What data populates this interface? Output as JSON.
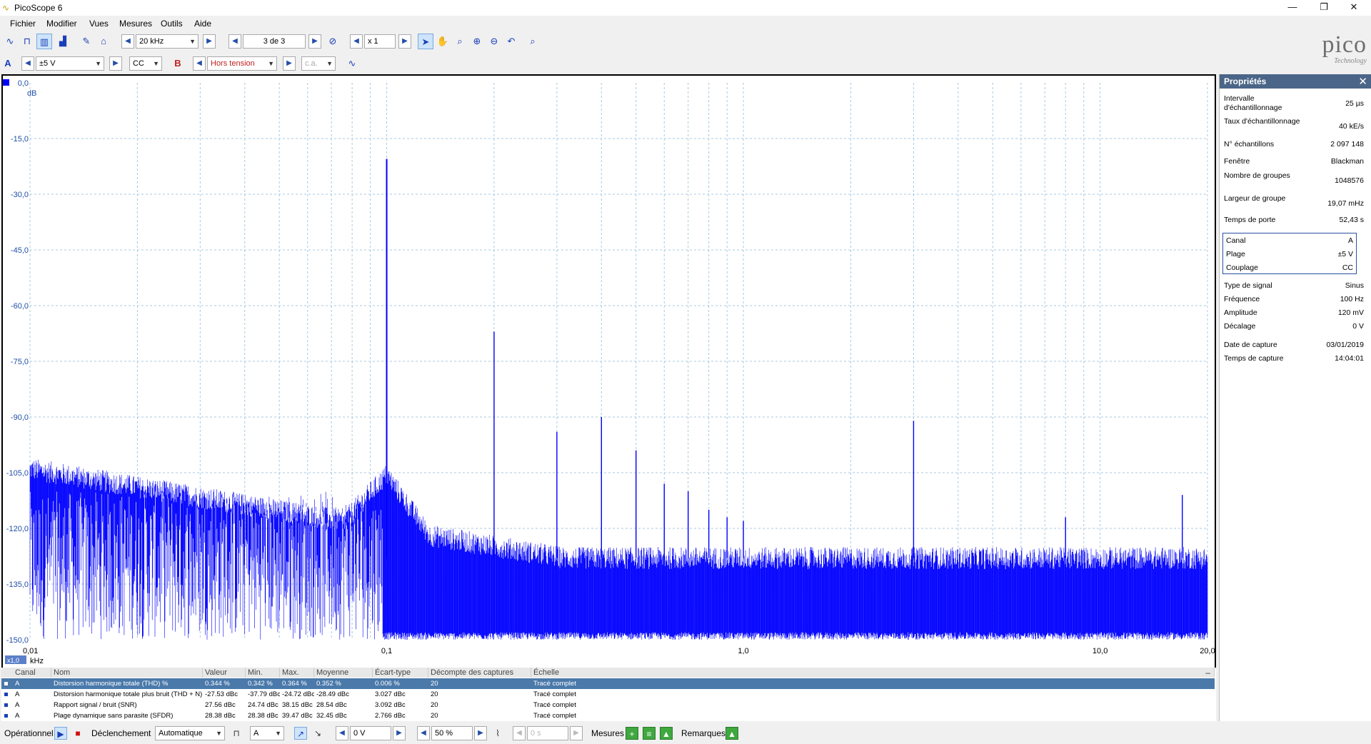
{
  "window": {
    "title": "PicoScope 6",
    "minimize": "—",
    "maximize": "❐",
    "close": "✕"
  },
  "menu": [
    "Fichier",
    "Modifier",
    "Vues",
    "Mesures",
    "Outils",
    "Aide"
  ],
  "toolbar": {
    "timebase": "20 kHz",
    "capture_page": "3 de 3",
    "zoom": "x 1"
  },
  "channel_toolbar": {
    "channel_a_label": "A",
    "channel_a_range": "±5 V",
    "channel_a_coupling": "CC",
    "channel_b_label": "B",
    "channel_b_range": "Hors tension",
    "channel_b_coupling": "c.a."
  },
  "logo": {
    "text": "pico",
    "sub": "Technology"
  },
  "plot": {
    "y_unit": "dB",
    "x_unit": "kHz",
    "x_scale_badge": "x1,0",
    "y_ticks": [
      "0,0",
      "-15,0",
      "-30,0",
      "-45,0",
      "-60,0",
      "-75,0",
      "-90,0",
      "-105,0",
      "-120,0",
      "-135,0",
      "-150,0"
    ],
    "x_ticks": [
      "0,01",
      "0,1",
      "1,0",
      "10,0",
      "20,0"
    ],
    "trace_color": "#0000ff",
    "grid_color": "#a8c8e0"
  },
  "chart_data": {
    "type": "line",
    "title": "",
    "xlabel": "kHz",
    "ylabel": "dB",
    "x_scale": "log",
    "xlim": [
      0.01,
      20.0
    ],
    "ylim": [
      -150,
      0
    ],
    "grid": true,
    "series": [
      {
        "x": [
          0.1,
          0.2,
          0.3,
          0.4,
          0.5,
          0.6,
          0.7,
          0.8,
          0.9,
          1.0,
          3.0,
          8.0,
          17.0
        ],
        "values": [
          -20.5,
          -67,
          -94,
          -90,
          -99,
          -108,
          -110,
          -115,
          -117,
          -118,
          -91,
          -117,
          -111
        ]
      }
    ],
    "noise_floor": {
      "low_freq": -107,
      "high_freq": -131
    }
  },
  "properties": {
    "header": "Propriétés",
    "close": "✕",
    "rows": [
      {
        "label": "Intervalle d'échantillonnage",
        "value": "25 µs"
      },
      {
        "label": "Taux d'échantillonnage",
        "value": "40 kE/s"
      },
      {
        "label": "N° échantillons",
        "value": "2 097 148"
      },
      {
        "label": "Fenêtre",
        "value": "Blackman"
      },
      {
        "label": "Nombre de groupes",
        "value": "1048576"
      },
      {
        "label": "Largeur de groupe",
        "value": "19,07 mHz"
      },
      {
        "label": "Temps de porte",
        "value": "52,43 s"
      }
    ],
    "channel_rows": [
      {
        "label": "Canal",
        "value": "A"
      },
      {
        "label": "Plage",
        "value": "±5 V"
      },
      {
        "label": "Couplage",
        "value": "CC"
      }
    ],
    "signal_rows": [
      {
        "label": "Type de signal",
        "value": "Sinus"
      },
      {
        "label": "Fréquence",
        "value": "100 Hz"
      },
      {
        "label": "Amplitude",
        "value": "120 mV"
      },
      {
        "label": "Décalage",
        "value": "0 V"
      }
    ],
    "capture_rows": [
      {
        "label": "Date de capture",
        "value": "03/01/2019"
      },
      {
        "label": "Temps de capture",
        "value": "14:04:01"
      }
    ]
  },
  "measurements": {
    "headers": [
      "Canal",
      "Nom",
      "Valeur",
      "Min.",
      "Max.",
      "Moyenne",
      "Écart-type",
      "Décompte des captures",
      "Échelle"
    ],
    "rows": [
      [
        "A",
        "Distorsion harmonique totale (THD) %",
        "0.344 %",
        "0.342 %",
        "0.364 %",
        "0.352 %",
        "0.006 %",
        "20",
        "Tracé complet"
      ],
      [
        "A",
        "Distorsion harmonique totale plus bruit (THD + N)",
        "-27.53 dBc",
        "-37.79 dBc",
        "-24.72 dBc",
        "-28.49 dBc",
        "3.027 dBc",
        "20",
        "Tracé complet"
      ],
      [
        "A",
        "Rapport signal / bruit (SNR)",
        "27.56 dBc",
        "24.74 dBc",
        "38.15 dBc",
        "28.54 dBc",
        "3.092 dBc",
        "20",
        "Tracé complet"
      ],
      [
        "A",
        "Plage dynamique sans parasite (SFDR)",
        "28.38 dBc",
        "28.38 dBc",
        "39.47 dBc",
        "32.45 dBc",
        "2.766 dBc",
        "20",
        "Tracé complet"
      ]
    ]
  },
  "statusbar": {
    "mode": "Opérationnel",
    "trigger_label": "Déclenchement",
    "trigger_mode": "Automatique",
    "trigger_channel": "A",
    "trigger_level": "0 V",
    "pretrigger": "50 %",
    "delay": "0 s",
    "measures_label": "Mesures",
    "notes_label": "Remarques"
  }
}
